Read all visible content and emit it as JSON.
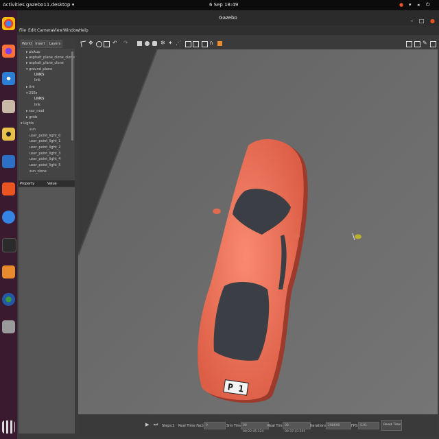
{
  "topbar": {
    "activities": "Activities",
    "app_menu": "gazebo11.desktop ▾",
    "clock": "6 Sep 18:49"
  },
  "window": {
    "title": "Gazebo"
  },
  "menu": [
    "File",
    "Edit",
    "Camera",
    "View",
    "Window",
    "Help"
  ],
  "tabs": [
    "World",
    "Insert",
    "Layers"
  ],
  "tree": [
    "▸ pickup",
    "▸ asphalt_plane_clone_clone",
    "▸ asphalt_plane_clone",
    "▾ ground_plane",
    "LINKS",
    "link",
    "▸ tire",
    "▾ 2SEz",
    "LINKS",
    "link",
    "▸ sav_mod",
    "▸ grids",
    "▾ Lights",
    "sun",
    "user_point_light_0",
    "user_point_light_1",
    "user_point_light_2",
    "user_point_light_3",
    "user_point_light_4",
    "user_point_light_5",
    "sun_clone"
  ],
  "properties": {
    "col1": "Property",
    "col2": "Value"
  },
  "bottom": {
    "steps_label": "Steps:",
    "steps_value": "1",
    "rtf_label": "Real Time Factor:",
    "rtf_value": "0",
    "sim_label": "Sim Time:",
    "sim_value": "00 00:22:45.324",
    "real_label": "Real Time:",
    "real_value": "00 00:37:43.555",
    "iter_label": "Iterations:",
    "iter_value": "298698",
    "fps_label": "FPS:",
    "fps_value": "5.91",
    "reset_label": "Reset Time"
  },
  "plate": "P 1",
  "colors": {
    "car": "#f0705a",
    "viewport": "#6b6b6b",
    "accent": "#e95420"
  }
}
